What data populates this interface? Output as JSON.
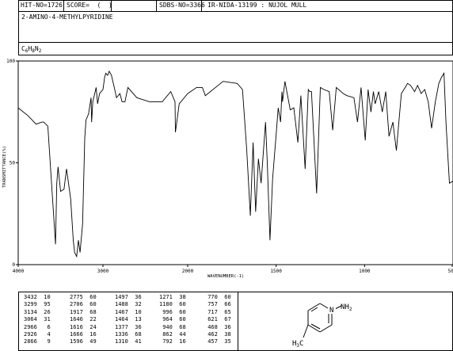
{
  "header": {
    "hit_no": "HIT-NO=1726",
    "score": "SCORE=  (  )",
    "sdbs_no": "SDBS-NO=3366",
    "ir_info": "IR-NIDA-13199 : NUJOL MULL"
  },
  "compound": {
    "name": "2-AMINO-4-METHYLPYRIDINE",
    "formula_prefix": "C",
    "formula_c": "6",
    "formula_h": "H",
    "formula_h_n": "8",
    "formula_n": "N",
    "formula_n_n": "2"
  },
  "chart_data": {
    "type": "line",
    "xlabel": "WAVENUMBER(-1)",
    "ylabel": "TRANSMITTANCE(%)",
    "x_ticks": [
      "4000",
      "3000",
      "2000",
      "1500",
      "1000",
      "500"
    ],
    "y_ticks": [
      "100",
      "50",
      "0"
    ],
    "ylim": [
      0,
      100
    ],
    "series": [
      {
        "x": [
          4000,
          3880,
          3790,
          3720,
          3700,
          3650,
          3560,
          3545,
          3530,
          3500,
          3460,
          3430,
          3420,
          3380,
          3350,
          3335,
          3310,
          3290,
          3270,
          3240,
          3215,
          3200,
          3170,
          3140,
          3134,
          3120,
          3080,
          3064,
          3040,
          3000,
          2980,
          2966,
          2945,
          2926,
          2900,
          2866,
          2840,
          2800,
          2775,
          2740,
          2706,
          2600,
          2450,
          2300,
          2200,
          2150,
          2145,
          2100,
          2000,
          1950,
          1917,
          1900,
          1800,
          1720,
          1690,
          1666,
          1646,
          1630,
          1616,
          1600,
          1585,
          1560,
          1550,
          1535,
          1520,
          1497,
          1488,
          1475,
          1467,
          1464,
          1450,
          1420,
          1400,
          1377,
          1360,
          1336,
          1318,
          1310,
          1300,
          1271,
          1250,
          1230,
          1200,
          1180,
          1160,
          1120,
          1100,
          1060,
          1040,
          1020,
          996,
          980,
          964,
          950,
          940,
          920,
          900,
          880,
          862,
          840,
          820,
          792,
          770,
          757,
          740,
          717,
          700,
          680,
          660,
          640,
          621,
          600,
          580,
          565,
          551,
          540,
          520,
          500,
          487,
          468,
          462,
          457,
          445,
          430,
          420
        ],
        "y": [
          77,
          73,
          69,
          70,
          70,
          68,
          10,
          40,
          48,
          36,
          37,
          47,
          44,
          32,
          12,
          6,
          4,
          12,
          6,
          20,
          62,
          71,
          74,
          82,
          70,
          80,
          87,
          79,
          84,
          86,
          92,
          94,
          93,
          95,
          93,
          87,
          82,
          84,
          80,
          80,
          87,
          82,
          80,
          80,
          85,
          80,
          65,
          79,
          84,
          87,
          87,
          83,
          90,
          89,
          86,
          56,
          24,
          60,
          26,
          52,
          40,
          70,
          50,
          12,
          42,
          67,
          77,
          70,
          85,
          80,
          90,
          76,
          77,
          60,
          83,
          47,
          86,
          85,
          85,
          35,
          87,
          86,
          85,
          66,
          87,
          84,
          83,
          82,
          70,
          87,
          61,
          86,
          75,
          85,
          79,
          85,
          75,
          85,
          63,
          70,
          56,
          84,
          87,
          89,
          88,
          85,
          88,
          84,
          86,
          80,
          67,
          80,
          89,
          92,
          94,
          70,
          40,
          41,
          45,
          35,
          40,
          46,
          55,
          47,
          42
        ]
      }
    ],
    "peaks": [
      [
        "3432",
        "10"
      ],
      [
        "3299",
        "95"
      ],
      [
        "3134",
        "26"
      ],
      [
        "3064",
        "31"
      ],
      [
        "2966",
        "6"
      ],
      [
        "2926",
        "4"
      ],
      [
        "2866",
        "9"
      ],
      [
        "2775",
        "60"
      ],
      [
        "2706",
        "60"
      ],
      [
        "1917",
        "68"
      ],
      [
        "1646",
        "22"
      ],
      [
        "1616",
        "24"
      ],
      [
        "1666",
        "16"
      ],
      [
        "1596",
        "49"
      ],
      [
        "1497",
        "36"
      ],
      [
        "1488",
        "32"
      ],
      [
        "1467",
        "10"
      ],
      [
        "1464",
        "13"
      ],
      [
        "1377",
        "36"
      ],
      [
        "1336",
        "68"
      ],
      [
        "1310",
        "41"
      ],
      [
        "1271",
        "38"
      ],
      [
        "1180",
        "60"
      ],
      [
        "996",
        "60"
      ],
      [
        "964",
        "60"
      ],
      [
        "940",
        "68"
      ],
      [
        "862",
        "44"
      ],
      [
        "792",
        "16"
      ],
      [
        "770",
        "60"
      ],
      [
        "757",
        "66"
      ],
      [
        "717",
        "65"
      ],
      [
        "621",
        "67"
      ],
      [
        "468",
        "36"
      ],
      [
        "462",
        "38"
      ],
      [
        "457",
        "35"
      ]
    ]
  },
  "structure": {
    "ring_n": "N",
    "nh2_prefix": "NH",
    "nh2_sub": "2",
    "ch3_h": "H",
    "ch3_3": "3",
    "ch3_c": "C"
  }
}
